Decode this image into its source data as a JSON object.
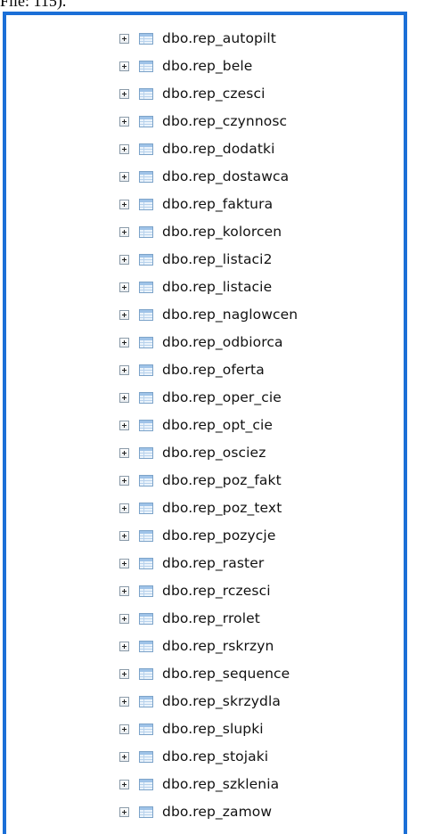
{
  "caption": "File: 115).",
  "tree": {
    "items": [
      {
        "label": "dbo.rep_autopilt"
      },
      {
        "label": "dbo.rep_bele"
      },
      {
        "label": "dbo.rep_czesci"
      },
      {
        "label": "dbo.rep_czynnosc"
      },
      {
        "label": "dbo.rep_dodatki"
      },
      {
        "label": "dbo.rep_dostawca"
      },
      {
        "label": "dbo.rep_faktura"
      },
      {
        "label": "dbo.rep_kolorcen"
      },
      {
        "label": "dbo.rep_listaci2"
      },
      {
        "label": "dbo.rep_listacie"
      },
      {
        "label": "dbo.rep_naglowcen"
      },
      {
        "label": "dbo.rep_odbiorca"
      },
      {
        "label": "dbo.rep_oferta"
      },
      {
        "label": "dbo.rep_oper_cie"
      },
      {
        "label": "dbo.rep_opt_cie"
      },
      {
        "label": "dbo.rep_osciez"
      },
      {
        "label": "dbo.rep_poz_fakt"
      },
      {
        "label": "dbo.rep_poz_text"
      },
      {
        "label": "dbo.rep_pozycje"
      },
      {
        "label": "dbo.rep_raster"
      },
      {
        "label": "dbo.rep_rczesci"
      },
      {
        "label": "dbo.rep_rrolet"
      },
      {
        "label": "dbo.rep_rskrzyn"
      },
      {
        "label": "dbo.rep_sequence"
      },
      {
        "label": "dbo.rep_skrzydla"
      },
      {
        "label": "dbo.rep_slupki"
      },
      {
        "label": "dbo.rep_stojaki"
      },
      {
        "label": "dbo.rep_szklenia"
      },
      {
        "label": "dbo.rep_zamow"
      }
    ]
  }
}
